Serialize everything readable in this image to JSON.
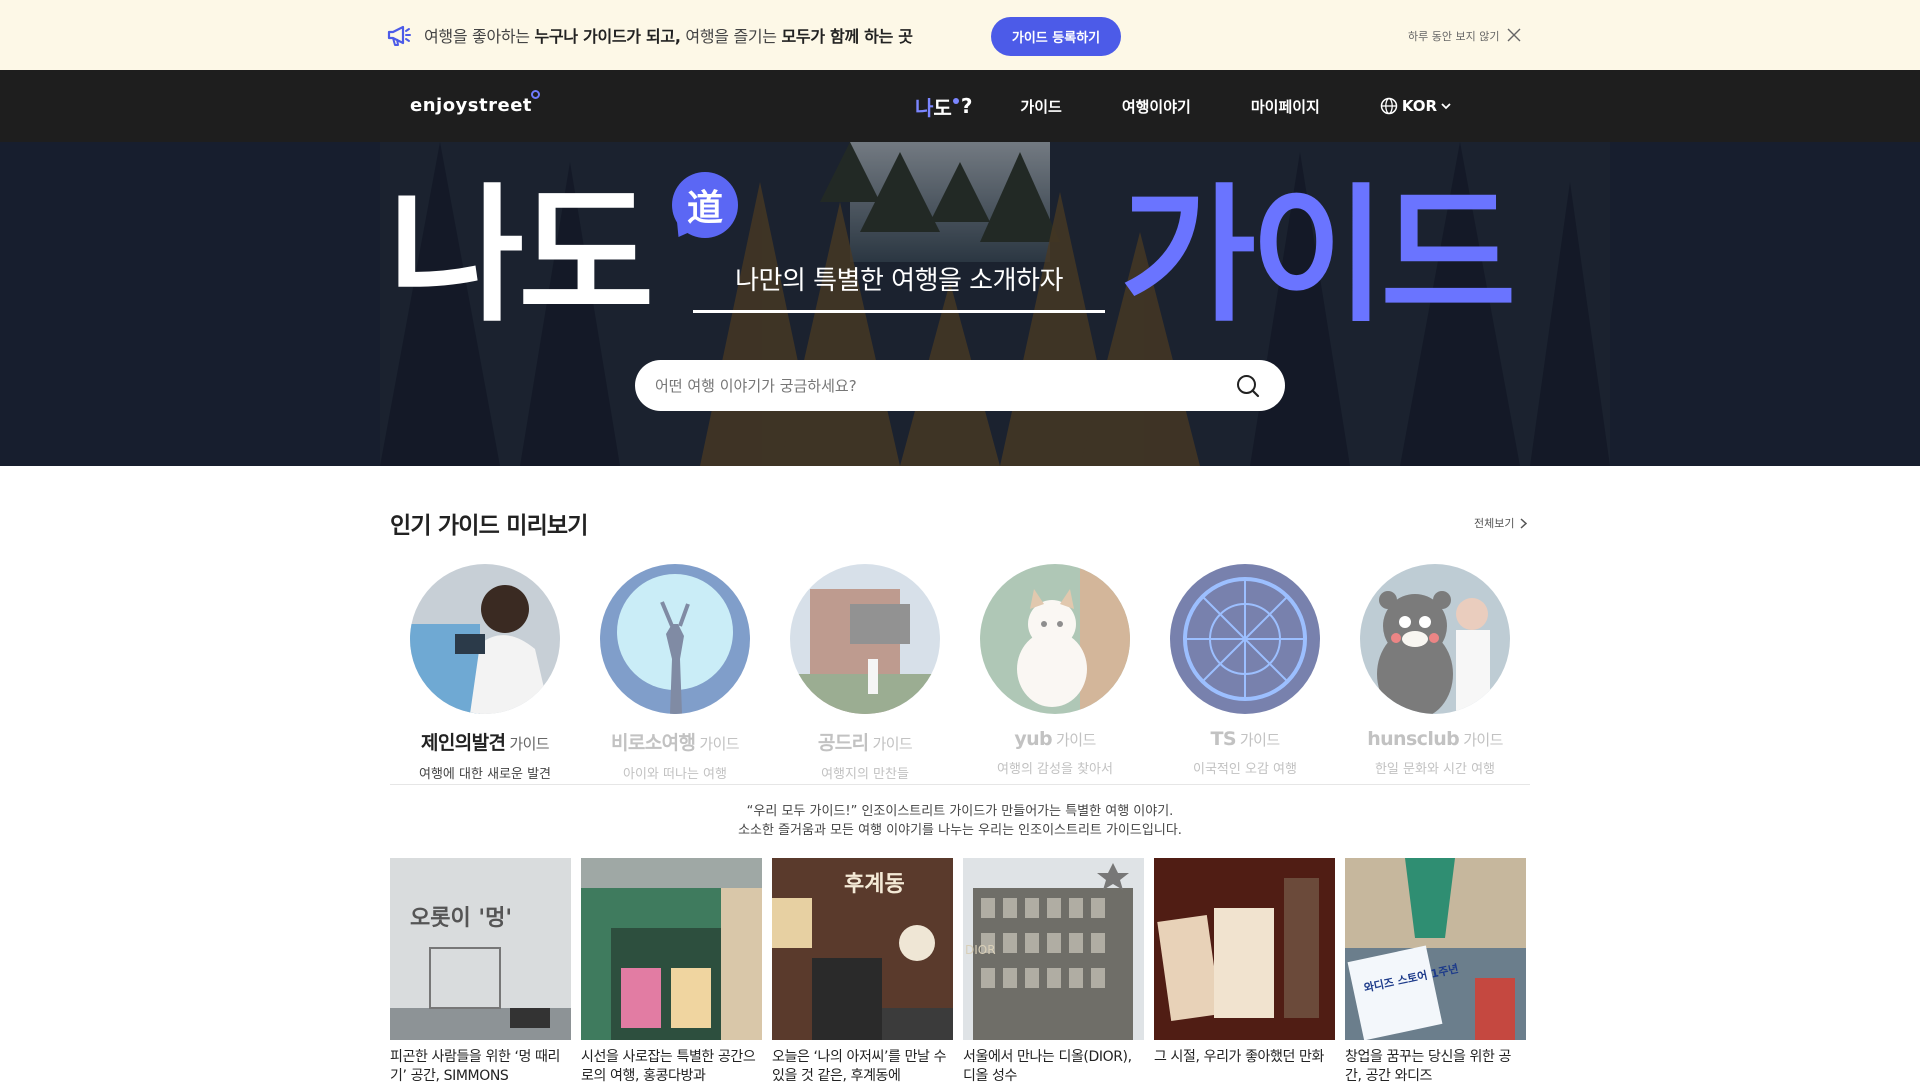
{
  "promo": {
    "text_parts": [
      "여행을 좋아하는 ",
      "누구나 가이드가 되고,",
      " 여행을 즐기는 ",
      "모두가 함께 하는 곳"
    ],
    "button_label": "가이드 등록하기",
    "dismiss_label": "하루 동안 보지 않기"
  },
  "nav": {
    "logo": "enjoystreet",
    "brand_a": "나",
    "brand_b": "도",
    "brand_c": "?",
    "items": [
      "가이드",
      "여행이야기",
      "마이페이지"
    ],
    "language": "KOR"
  },
  "hero": {
    "title_left_a": "나",
    "title_left_b": "도",
    "badge": "道",
    "subtitle": "나만의 특별한 여행을 소개하자",
    "title_right": "가이드",
    "search_placeholder": "어떤 여행 이야기가 궁금하세요?"
  },
  "popular": {
    "title": "인기 가이드 미리보기",
    "view_all": "전체보기",
    "guide_suffix": "가이드",
    "guides": [
      {
        "name": "제인의발견",
        "desc": "여행에 대한 새로운 발견"
      },
      {
        "name": "비로소여행",
        "desc": "아이와 떠나는 여행"
      },
      {
        "name": "공드리",
        "desc": "여행지의 만찬들"
      },
      {
        "name": "yub",
        "desc": "여행의 감성을 찾아서"
      },
      {
        "name": "TS",
        "desc": "이국적인 오감 여행"
      },
      {
        "name": "hunsclub",
        "desc": "한일 문화와 시간 여행"
      }
    ]
  },
  "quote": {
    "line1": "“우리 모두 가이드!” 인조이스트리트 가이드가 만들어가는 특별한 여행 이야기.",
    "line2": "소소한 즐거움과 모든 여행 이야기를 나누는 우리는 인조이스트리트 가이드입니다."
  },
  "stories": [
    {
      "caption": "피곤한 사람들을 위한 ‘멍 때리기’ 공간, SIMMONS",
      "image_text": "오롯이 '멍'"
    },
    {
      "caption": "시선을 사로잡는 특별한 공간으로의 여행, 홍콩다방과",
      "image_text": ""
    },
    {
      "caption": "오늘은 ‘나의 아저씨’를 만날 수 있을 것 같은, 후계동에",
      "image_text": "후계동"
    },
    {
      "caption": "서울에서 만나는 디올(DIOR), 디올 성수",
      "image_text": "DIOR"
    },
    {
      "caption": "그 시절, 우리가 좋아했던 만화",
      "image_text": ""
    },
    {
      "caption": "창업을 꿈꾸는 당신을 위한 공간, 공간 와디즈",
      "image_text": "와디즈 스토어 1주년"
    }
  ]
}
